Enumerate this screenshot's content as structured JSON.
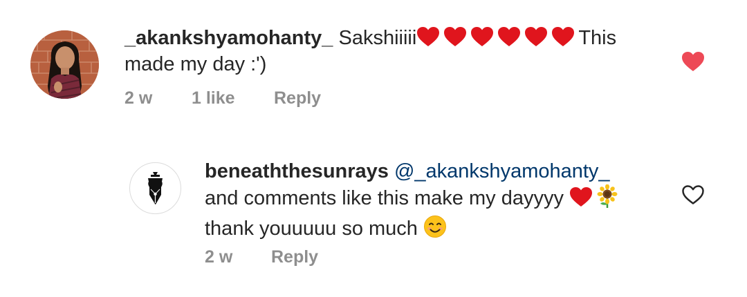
{
  "comments": [
    {
      "username": "_akankshyamohanty_",
      "text_before_hearts": "Sakshiiiii",
      "heart_count": 6,
      "text_after_hearts": "This made my day :')",
      "time": "2 w",
      "likes": "1 like",
      "reply_label": "Reply",
      "liked": true
    },
    {
      "username": "beneaththesunrays",
      "mention": "@_akankshyamohanty_",
      "line1": "and comments like this make my dayyyy",
      "line2": "thank youuuuu so much",
      "time": "2 w",
      "reply_label": "Reply",
      "liked": false
    }
  ],
  "colors": {
    "text": "#262626",
    "meta": "#8e8e8e",
    "mention": "#00376b",
    "heart_red": "#ed4956",
    "emoji_heart": "#e0151d",
    "outline_heart": "#262626"
  },
  "icons": {
    "inline_heart": "red-heart-emoji-icon",
    "sunflower": "sunflower-emoji-icon",
    "smile": "smiling-face-emoji-icon",
    "like_filled": "heart-filled-icon",
    "like_outline": "heart-outline-icon",
    "avatar2_logo": "fountain-pen-nib-icon"
  }
}
